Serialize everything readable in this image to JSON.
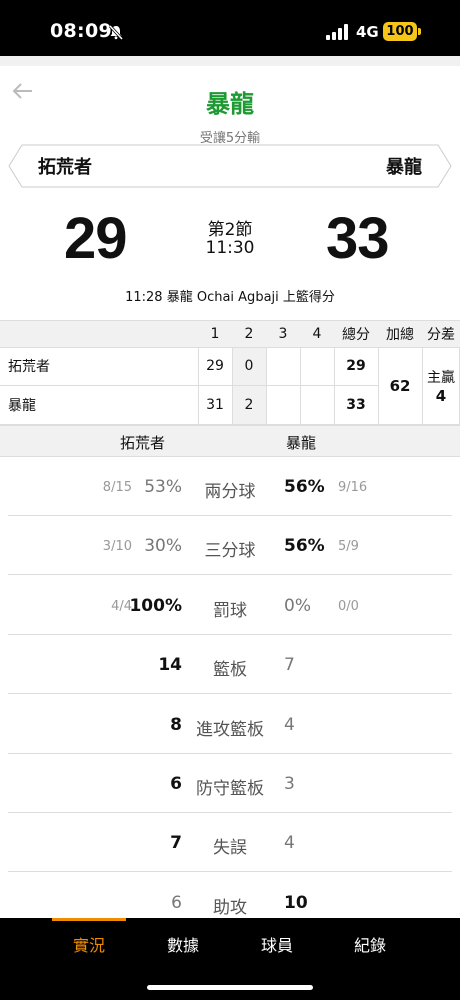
{
  "status_bar": {
    "time": "08:09",
    "network": "4G",
    "battery": "100"
  },
  "header": {
    "title": "暴龍",
    "handicap": "受讓5分輸",
    "title_color": "#1d9a32"
  },
  "teams": {
    "left": "拓荒者",
    "right": "暴龍"
  },
  "score": {
    "left": "29",
    "right": "33",
    "period": "第2節",
    "clock": "11:30"
  },
  "last_play": "11:28 暴龍 Ochai Agbaji 上籃得分",
  "box_score": {
    "headers": [
      "1",
      "2",
      "3",
      "4",
      "總分",
      "加總",
      "分差"
    ],
    "rows": [
      {
        "team": "拓荒者",
        "q": [
          "29",
          "0",
          "",
          ""
        ],
        "total": "29"
      },
      {
        "team": "暴龍",
        "q": [
          "31",
          "2",
          "",
          ""
        ],
        "total": "33"
      }
    ],
    "sum": "62",
    "diff_label": "主贏",
    "diff_value": "4"
  },
  "split_header": {
    "left": "拓荒者",
    "right": "暴龍"
  },
  "stats": [
    {
      "label": "兩分球",
      "left_sub": "8/15",
      "left": "53%",
      "right": "56%",
      "right_sub": "9/16",
      "bold": "right"
    },
    {
      "label": "三分球",
      "left_sub": "3/10",
      "left": "30%",
      "right": "56%",
      "right_sub": "5/9",
      "bold": "right"
    },
    {
      "label": "罰球",
      "left_sub": "4/4",
      "left": "100%",
      "right": "0%",
      "right_sub": "0/0",
      "bold": "left"
    },
    {
      "label": "籃板",
      "left_sub": "",
      "left": "14",
      "right": "7",
      "right_sub": "",
      "bold": "left"
    },
    {
      "label": "進攻籃板",
      "left_sub": "",
      "left": "8",
      "right": "4",
      "right_sub": "",
      "bold": "left"
    },
    {
      "label": "防守籃板",
      "left_sub": "",
      "left": "6",
      "right": "3",
      "right_sub": "",
      "bold": "left"
    },
    {
      "label": "失誤",
      "left_sub": "",
      "left": "7",
      "right": "4",
      "right_sub": "",
      "bold": "left"
    },
    {
      "label": "助攻",
      "left_sub": "",
      "left": "6",
      "right": "10",
      "right_sub": "",
      "bold": "right"
    }
  ],
  "tabs": [
    {
      "label": "實況",
      "active": true
    },
    {
      "label": "數據",
      "active": false
    },
    {
      "label": "球員",
      "active": false
    },
    {
      "label": "紀錄",
      "active": false
    }
  ],
  "colors": {
    "accent": "#f08c00",
    "battery": "#f5c518"
  }
}
